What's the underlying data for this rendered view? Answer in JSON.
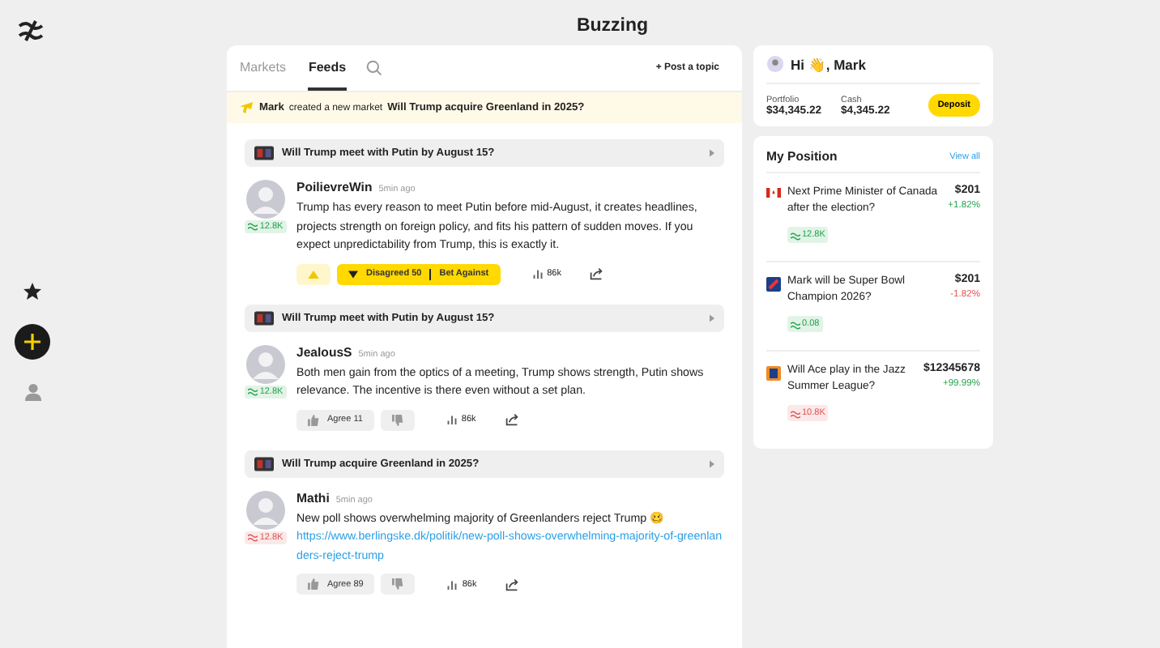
{
  "app_title": "Buzzing",
  "rail": {
    "items": [
      {
        "kind": "star"
      },
      {
        "kind": "add"
      },
      {
        "kind": "user"
      }
    ]
  },
  "feed": {
    "tabs": [
      {
        "label": "Markets",
        "selected": false
      },
      {
        "label": "Feeds",
        "selected": true
      }
    ],
    "post_topic": "+ Post a topic",
    "notice": {
      "user": "Mark",
      "action": "created a new market",
      "market": "Will Trump acquire Greenland in 2025?"
    },
    "posts": [
      {
        "market": "Will Trump meet with Putin by August 15?",
        "author": "PoilievreWin",
        "time": "5min ago",
        "badge": {
          "text": "12.8K",
          "color": "#22a34a"
        },
        "body": "Trump has every reason to meet Putin before mid-August, it creates headlines, projects strength on foreign policy, and fits his pattern of sudden moves. If you expect unpredictability from Trump, this is exactly it.",
        "kind": "disagreed",
        "disagree": "Disagreed 50",
        "bet": "Bet Against",
        "views": "86k"
      },
      {
        "market": "Will Trump meet with Putin by August 15?",
        "author": "JealousS",
        "time": "5min ago",
        "badge": {
          "text": "12.8K",
          "color": "#22a34a"
        },
        "body": "Both men gain from the optics of a meeting, Trump shows strength, Putin shows relevance. The incentive is there even without a set plan.",
        "kind": "open",
        "agree": "Agree 11",
        "views": "86k"
      },
      {
        "market": "Will Trump acquire Greenland in 2025?",
        "author": "Mathi",
        "time": "5min ago",
        "badge": {
          "text": "12.8K",
          "color": "#e05252"
        },
        "body": "New poll shows overwhelming majority of Greenlanders reject Trump 🥴",
        "link": "https://www.berlingske.dk/politik/new-poll-shows-overwhelming-majority-of-greenlanders-reject-trump",
        "kind": "open",
        "agree": "Agree 89",
        "views": "86k"
      }
    ]
  },
  "account": {
    "greeting": "Hi 👋, Mark",
    "portfolio_label": "Portfolio",
    "portfolio": "$34,345.22",
    "cash_label": "Cash",
    "cash": "$4,345.22",
    "deposit": "Deposit"
  },
  "positions": {
    "title": "My Position",
    "view_all": "View all",
    "items": [
      {
        "kind": "canada",
        "title": "Next Prime Minister of Canada after the election?",
        "price": "$201",
        "change": "+1.82%",
        "color": "#22a34a",
        "badge": {
          "text": "12.8K",
          "color": "#22a34a"
        }
      },
      {
        "kind": "football",
        "title": "Mark will be Super Bowl Champion 2026?",
        "price": "$201",
        "change": "-1.82%",
        "color": "#e05252",
        "badge": {
          "text": "0.08",
          "color": "#22a34a"
        }
      },
      {
        "kind": "jazz",
        "title": "Will Ace play in the Jazz Summer League?",
        "price": "$12345678",
        "change": "+99.99%",
        "color": "#22a34a",
        "badge": {
          "text": "10.8K",
          "color": "#e05252"
        }
      }
    ]
  }
}
